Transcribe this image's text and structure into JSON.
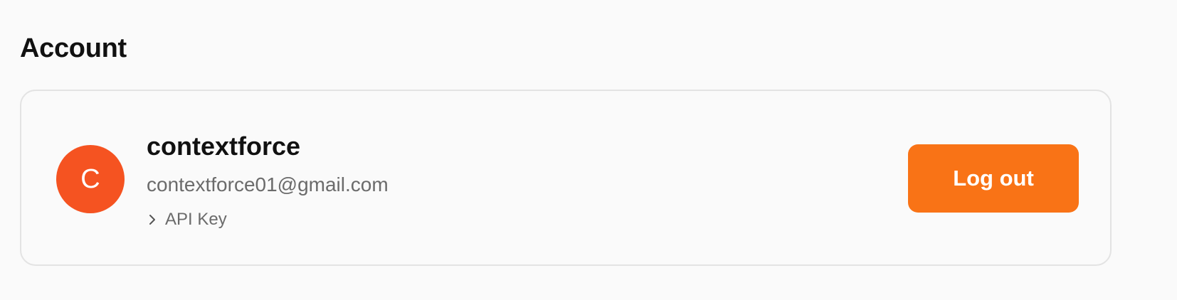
{
  "page": {
    "title": "Account"
  },
  "account": {
    "avatar_initial": "C",
    "username": "contextforce",
    "email": "contextforce01@gmail.com",
    "api_key_label": "API Key",
    "logout_label": "Log out"
  },
  "icons": {
    "api_key_toggle": "chevron-right-icon"
  },
  "colors": {
    "avatar_bg": "#f55321",
    "logout_bg": "#f97316",
    "text_primary": "#111111",
    "text_secondary": "#6b6b6b",
    "card_border": "#e3e3e3",
    "background": "#fafafa"
  }
}
